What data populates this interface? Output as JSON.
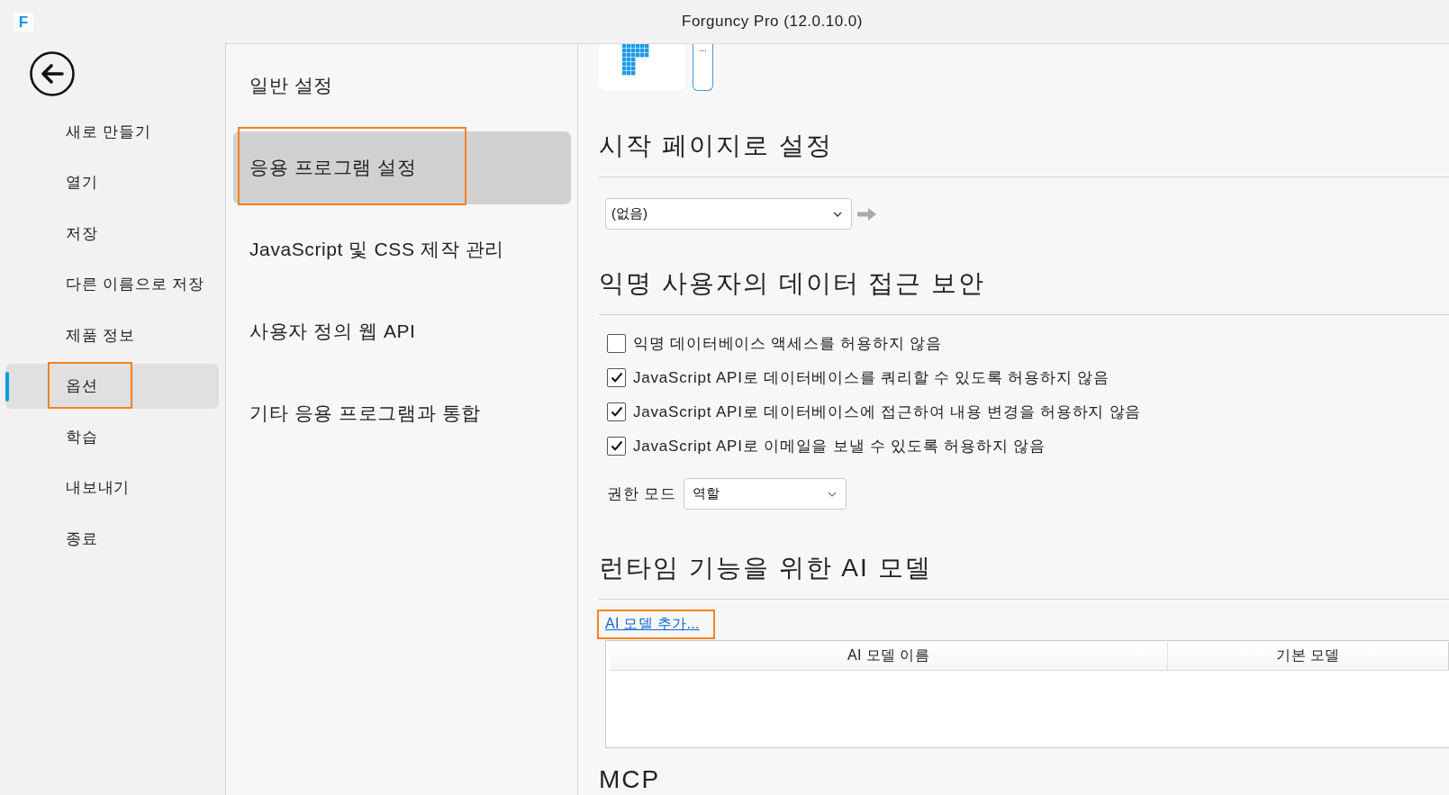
{
  "window": {
    "logo": "F",
    "title": "Forguncy Pro (12.0.10.0)"
  },
  "sidebar": {
    "items": [
      {
        "label": "새로 만들기",
        "selected": false,
        "highlighted": false
      },
      {
        "label": "열기",
        "selected": false,
        "highlighted": false
      },
      {
        "label": "저장",
        "selected": false,
        "highlighted": false
      },
      {
        "label": "다른 이름으로 저장",
        "selected": false,
        "highlighted": false
      },
      {
        "label": "제품 정보",
        "selected": false,
        "highlighted": false
      },
      {
        "label": "옵션",
        "selected": true,
        "highlighted": true
      },
      {
        "label": "학습",
        "selected": false,
        "highlighted": false
      },
      {
        "label": "내보내기",
        "selected": false,
        "highlighted": false
      },
      {
        "label": "종료",
        "selected": false,
        "highlighted": false
      }
    ]
  },
  "settings_nav": {
    "items": [
      {
        "label": "일반 설정",
        "selected": false,
        "highlighted": false
      },
      {
        "label": "응용 프로그램 설정",
        "selected": true,
        "highlighted": true
      },
      {
        "label": "JavaScript 및 CSS 제작 관리",
        "selected": false,
        "highlighted": false
      },
      {
        "label": "사용자 정의 웹 API",
        "selected": false,
        "highlighted": false
      },
      {
        "label": "기타 응용 프로그램과 통합",
        "selected": false,
        "highlighted": false
      }
    ]
  },
  "app_icon": {
    "button": "..."
  },
  "start_page": {
    "heading": "시작 페이지로 설정",
    "select": {
      "value": "(없음)"
    }
  },
  "anonymous_security": {
    "heading": "익명 사용자의 데이터 접근 보안",
    "options": [
      {
        "label": "익명 데이터베이스 액세스를 허용하지 않음",
        "checked": false
      },
      {
        "label": "JavaScript API로 데이터베이스를 쿼리할 수 있도록 허용하지 않음",
        "checked": true
      },
      {
        "label": "JavaScript API로 데이터베이스에 접근하여 내용 변경을 허용하지 않음",
        "checked": true
      },
      {
        "label": "JavaScript API로 이메일을 보낼 수 있도록 허용하지 않음",
        "checked": true
      }
    ],
    "permission_mode": {
      "label": "권한 모드",
      "value": "역할"
    }
  },
  "ai_models": {
    "heading": "런타임 기능을 위한 AI 모델",
    "add_link": {
      "label": "AI 모델 추가...",
      "highlighted": true
    },
    "table": {
      "columns": [
        "AI 모델 이름",
        "기본 모델"
      ]
    }
  },
  "mcp": {
    "heading": "MCP"
  }
}
